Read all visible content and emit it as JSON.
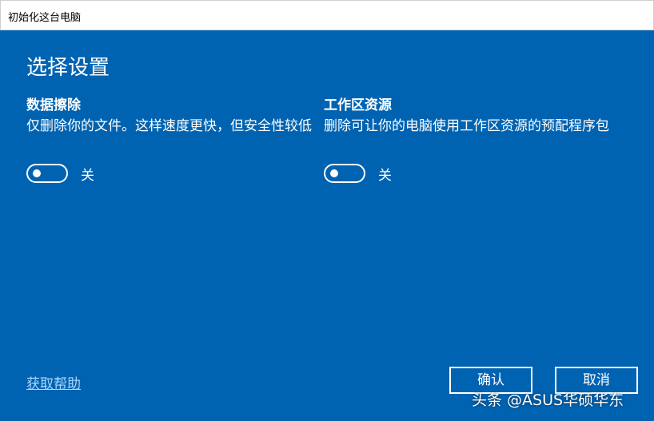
{
  "window": {
    "title": "初始化这台电脑"
  },
  "heading": "选择设置",
  "sections": [
    {
      "title": "数据擦除",
      "description": "仅删除你的文件。这样速度更快，但安全性较低",
      "toggle_state": "关",
      "toggle_on": false
    },
    {
      "title": "工作区资源",
      "description": "删除可让你的电脑使用工作区资源的预配程序包",
      "toggle_state": "关",
      "toggle_on": false
    }
  ],
  "help_link": "获取帮助",
  "buttons": {
    "ok": "确认",
    "cancel": "取消"
  },
  "watermark": "头条 @ASUS华硕华东",
  "colors": {
    "background": "#0063b1",
    "titlebar": "#ffffff",
    "link": "#a9d7ff",
    "text": "#ffffff"
  }
}
